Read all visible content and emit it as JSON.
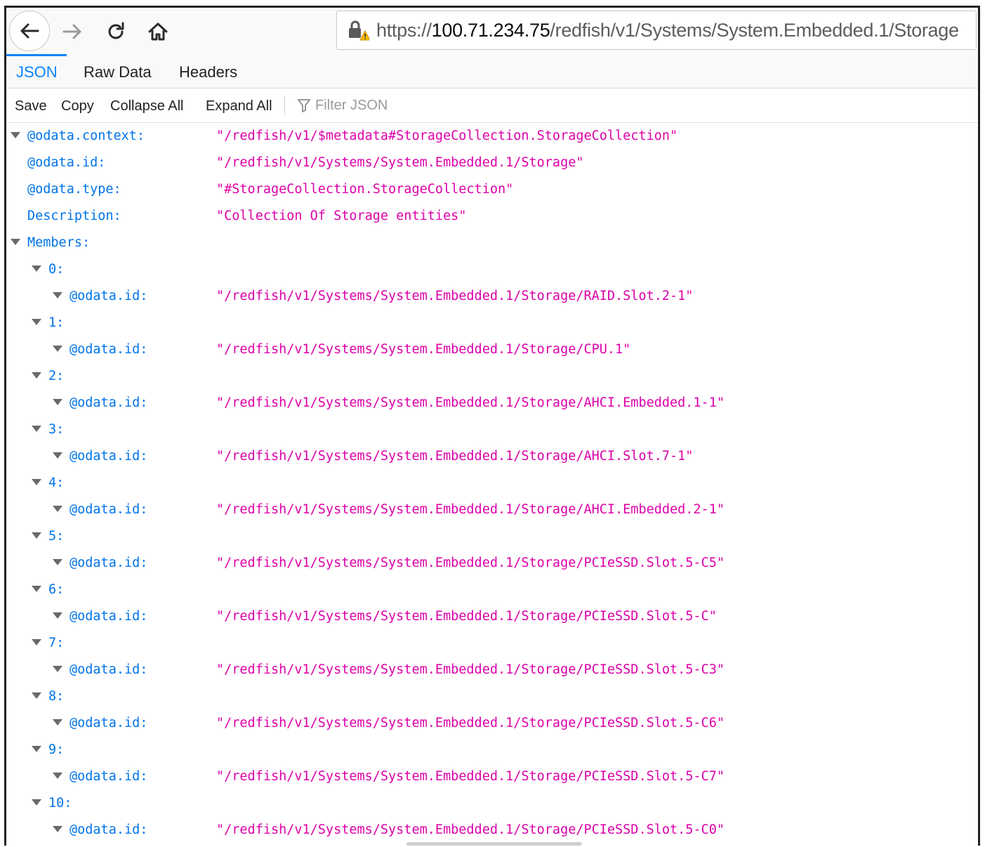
{
  "browser": {
    "url_scheme": "https://",
    "url_host": "100.71.234.75",
    "url_path": "/redfish/v1/Systems/System.Embedded.1/Storage"
  },
  "tabs": [
    "JSON",
    "Raw Data",
    "Headers"
  ],
  "actions": {
    "save": "Save",
    "copy": "Copy",
    "collapse_all": "Collapse All",
    "expand_all": "Expand All",
    "filter_placeholder": "Filter JSON"
  },
  "json": {
    "context_key": "@odata.context:",
    "context_val": "\"/redfish/v1/$metadata#StorageCollection.StorageCollection\"",
    "id_key": "@odata.id:",
    "id_val": "\"/redfish/v1/Systems/System.Embedded.1/Storage\"",
    "type_key": "@odata.type:",
    "type_val": "\"#StorageCollection.StorageCollection\"",
    "desc_key": "Description:",
    "desc_val": "\"Collection Of Storage entities\"",
    "members_key": "Members:",
    "member_id_key": "@odata.id:",
    "members": [
      {
        "index": "0:",
        "value": "\"/redfish/v1/Systems/System.Embedded.1/Storage/RAID.Slot.2-1\""
      },
      {
        "index": "1:",
        "value": "\"/redfish/v1/Systems/System.Embedded.1/Storage/CPU.1\""
      },
      {
        "index": "2:",
        "value": "\"/redfish/v1/Systems/System.Embedded.1/Storage/AHCI.Embedded.1-1\""
      },
      {
        "index": "3:",
        "value": "\"/redfish/v1/Systems/System.Embedded.1/Storage/AHCI.Slot.7-1\""
      },
      {
        "index": "4:",
        "value": "\"/redfish/v1/Systems/System.Embedded.1/Storage/AHCI.Embedded.2-1\""
      },
      {
        "index": "5:",
        "value": "\"/redfish/v1/Systems/System.Embedded.1/Storage/PCIeSSD.Slot.5-C5\""
      },
      {
        "index": "6:",
        "value": "\"/redfish/v1/Systems/System.Embedded.1/Storage/PCIeSSD.Slot.5-C\""
      },
      {
        "index": "7:",
        "value": "\"/redfish/v1/Systems/System.Embedded.1/Storage/PCIeSSD.Slot.5-C3\""
      },
      {
        "index": "8:",
        "value": "\"/redfish/v1/Systems/System.Embedded.1/Storage/PCIeSSD.Slot.5-C6\""
      },
      {
        "index": "9:",
        "value": "\"/redfish/v1/Systems/System.Embedded.1/Storage/PCIeSSD.Slot.5-C7\""
      },
      {
        "index": "10:",
        "value": "\"/redfish/v1/Systems/System.Embedded.1/Storage/PCIeSSD.Slot.5-C0\""
      }
    ]
  },
  "icons": [
    "back-arrow-icon",
    "forward-arrow-icon",
    "reload-icon",
    "home-icon",
    "insecure-lock-icon",
    "filter-funnel-icon",
    "expand-triangle-icon"
  ],
  "colors": {
    "json_key": "#0074e8",
    "json_string": "#dd00a9",
    "active_tab": "#0a84ff"
  }
}
